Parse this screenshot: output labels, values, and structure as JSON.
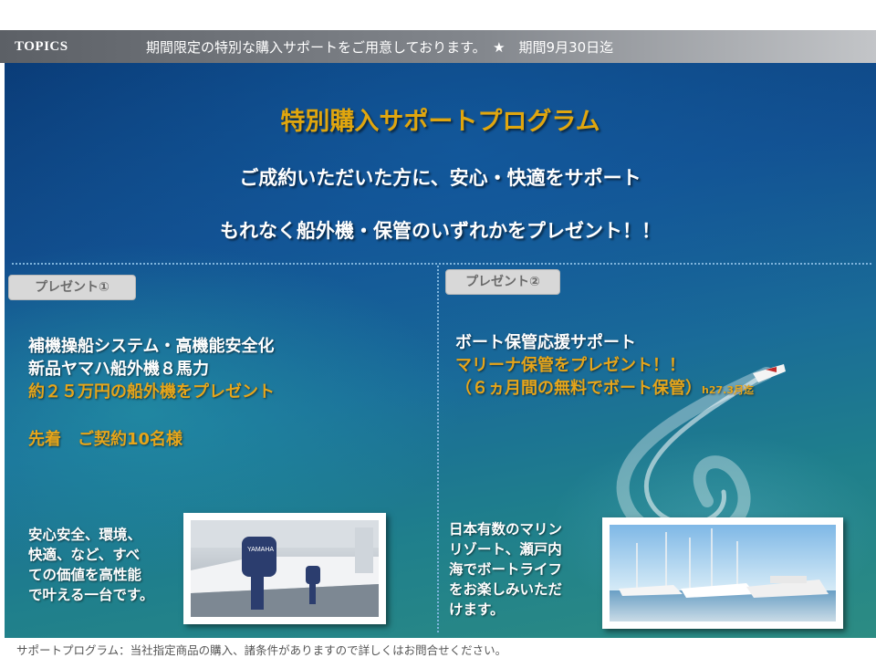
{
  "topics": {
    "label": "TOPICS",
    "message": "期間限定の特別な購入サポートをご用意しております。　★　期間9月30日迄"
  },
  "banner": {
    "title": "特別購入サポートプログラム",
    "subtitle1": "ご成約いただいた方に、安心・快適をサポート",
    "subtitle2": "もれなく船外機・保管のいずれかをプレゼント！！",
    "left": {
      "tag": "プレゼント①",
      "line1": "補機操船システム・高機能安全化",
      "line2": "新品ヤマハ船外機８馬力",
      "line3": "約２５万円の船外機をプレゼント",
      "limit": "先着　ご契約10名様",
      "para": [
        "安心安全、環境、",
        "快適、など、すべ",
        "ての価値を高性能",
        "で叶える一台です。"
      ]
    },
    "right": {
      "tag": "プレゼント②",
      "line1": "ボート保管応援サポート",
      "line2": "マリーナ保管をプレゼント！！",
      "line3": "（６ヵ月間の無料でボート保管）",
      "line3_note": "h27.3月迄",
      "para": [
        "日本有数のマリン",
        "リゾート、瀬戸内",
        "海でボートライフ",
        "をお楽しみいただ",
        "けます。"
      ]
    }
  },
  "footer": {
    "note": "サポートプログラム：当社指定商品の購入、諸条件がありますので詳しくはお問合せください。"
  },
  "colors": {
    "accent_gold": "#e6a51a",
    "ocean_dark": "#0a3c78",
    "ocean_teal": "#2c8c83",
    "tag_bg": "#d8d8d8"
  },
  "images": {
    "left_photo": "outboard-motor-photo",
    "right_photo": "marina-yachts-photo"
  }
}
